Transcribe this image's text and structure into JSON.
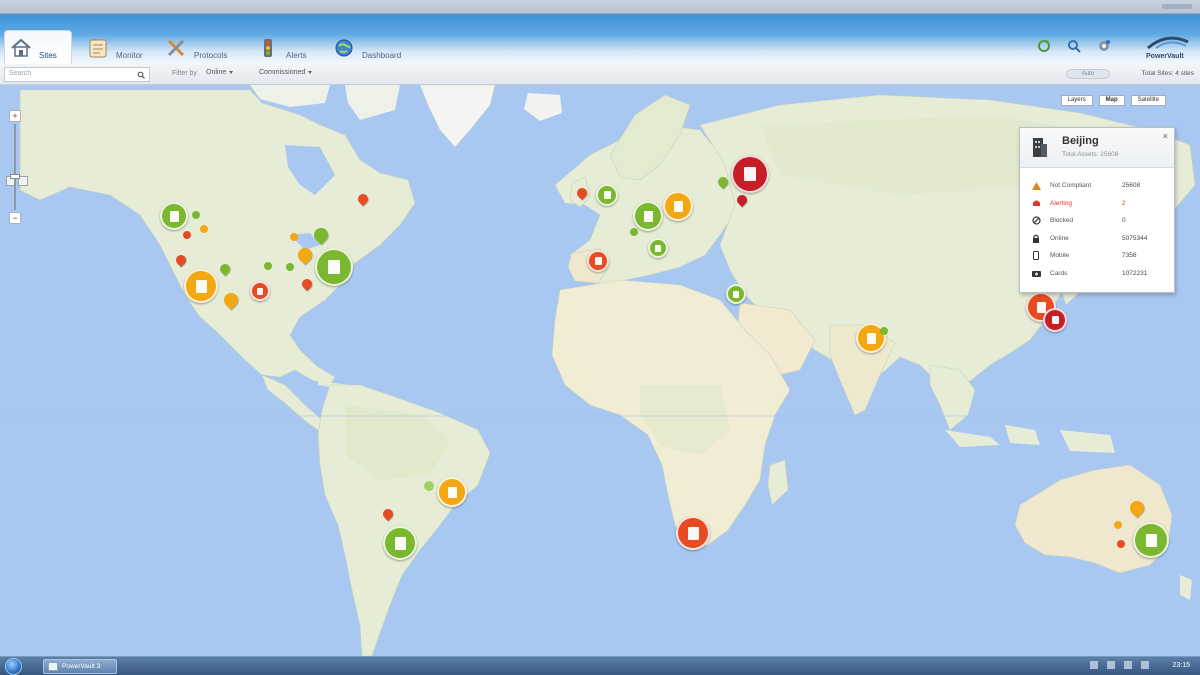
{
  "app": {
    "tabs": [
      {
        "label": "Sites",
        "icon": "home-icon",
        "active": true
      },
      {
        "label": "Monitor",
        "icon": "clipboard-icon",
        "active": false
      },
      {
        "label": "Protocols",
        "icon": "tools-icon",
        "active": false
      },
      {
        "label": "Alerts",
        "icon": "traffic-light-icon",
        "active": false
      },
      {
        "label": "Dashboard",
        "icon": "globe-icon",
        "active": false
      }
    ],
    "toolbar_icons": [
      "refresh-icon",
      "search-icon",
      "settings-icon"
    ],
    "brand": "PowerVault"
  },
  "filters": {
    "search_placeholder": "Search",
    "filter_by_label": "Filter by",
    "filter_value": "Online",
    "group_value": "Commissioned",
    "toggle_label": "Auto",
    "updated_text": "Total Sites: 4 sites"
  },
  "map": {
    "type_buttons": [
      "Layers",
      "Map",
      "Satellite"
    ],
    "zoom_in": "+",
    "zoom_out": "−"
  },
  "popup": {
    "city": "Beijing",
    "subtitle": "Total Assets: 25608",
    "close": "×",
    "rows": [
      {
        "icon": "warning-icon",
        "label": "Not Compliant",
        "value": "25608",
        "alert": false
      },
      {
        "icon": "alarm-icon",
        "label": "Alerting",
        "value": "2",
        "alert": true
      },
      {
        "icon": "blocked-icon",
        "label": "Blocked",
        "value": "0",
        "alert": false
      },
      {
        "icon": "lock-icon",
        "label": "Online",
        "value": "5075344",
        "alert": false
      },
      {
        "icon": "phone-icon",
        "label": "Mobile",
        "value": "7356",
        "alert": false
      },
      {
        "icon": "camera-icon",
        "label": "Cards",
        "value": "1072231",
        "alert": false
      }
    ]
  },
  "colors": {
    "green": "#7cb82f",
    "orange": "#f3a712",
    "red": "#e64b22",
    "darkred": "#c61d26",
    "sea": "#a8c8f2",
    "land": "#e9eedc"
  },
  "taskbar": {
    "task_label": "PowerVault 3",
    "clock": "23:15"
  }
}
